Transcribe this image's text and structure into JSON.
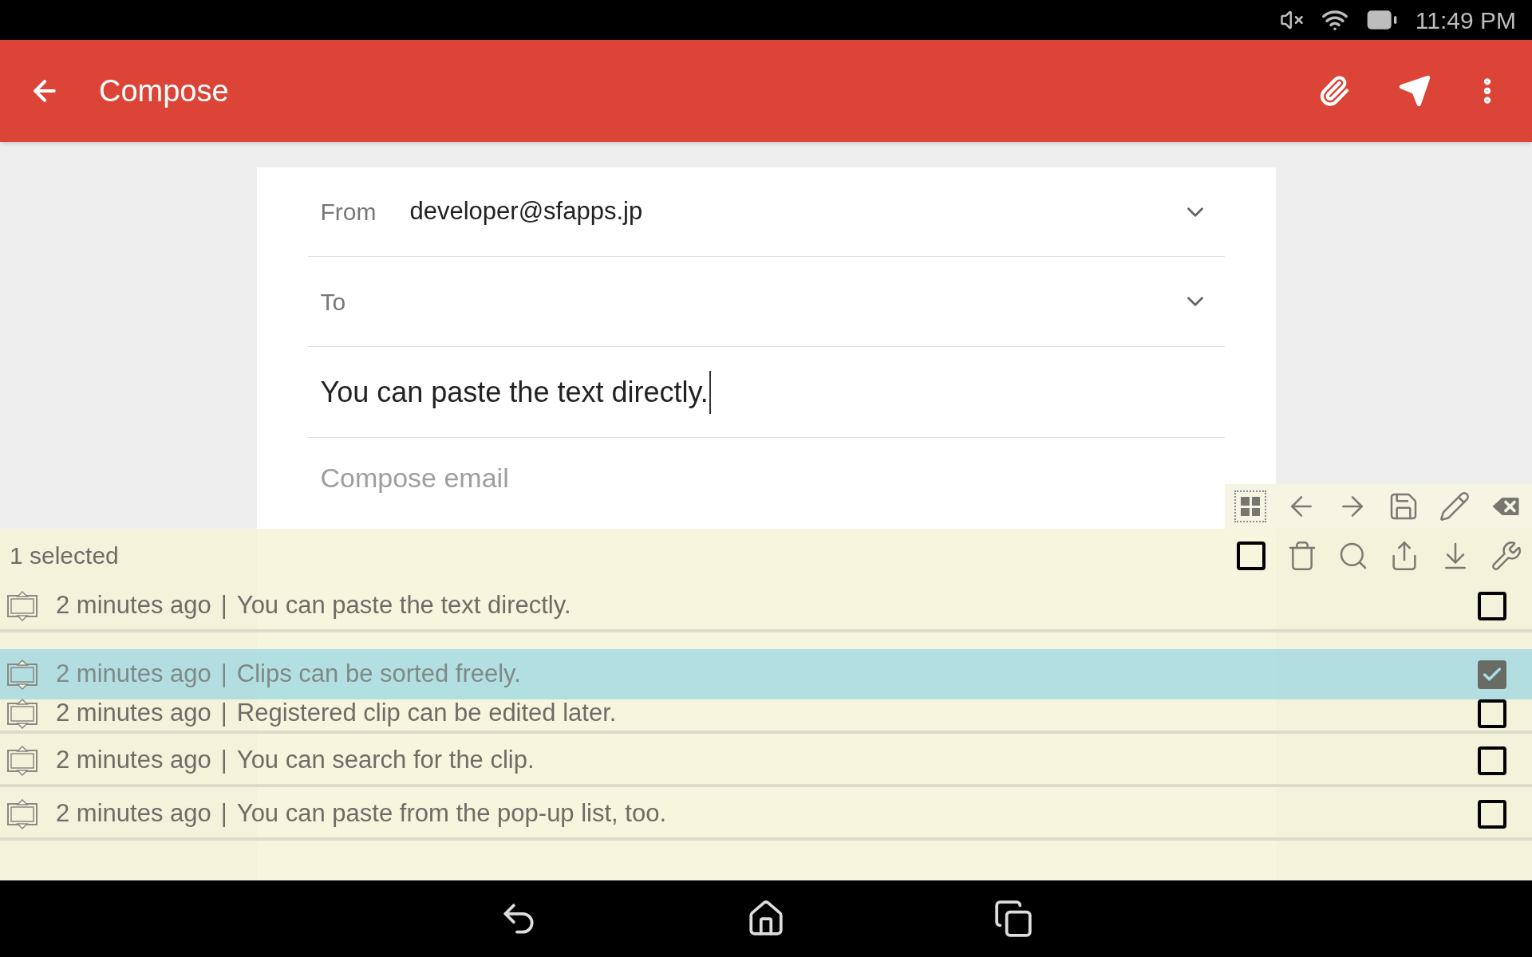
{
  "status_bar": {
    "time": "11:49 PM"
  },
  "app_bar": {
    "title": "Compose"
  },
  "form": {
    "from": {
      "label": "From",
      "value": "developer@sfapps.jp"
    },
    "to": {
      "label": "To"
    },
    "subject": {
      "value": "You can paste the text directly."
    },
    "body": {
      "placeholder": "Compose email"
    }
  },
  "clip_panel": {
    "status": "1 selected",
    "select_all": {
      "checked": false
    },
    "clips": [
      {
        "kind": "row",
        "time": "2 minutes ago",
        "separator": "|",
        "text": "You can paste the text directly.",
        "selected": false
      },
      {
        "kind": "dragged",
        "time": "2 minutes ago",
        "separator": "|",
        "text": "Clips can be sorted freely.",
        "selected": true
      },
      {
        "kind": "row",
        "time": "2 minutes ago",
        "separator": "|",
        "text": "Registered clip can be edited later.",
        "selected": false
      },
      {
        "kind": "row",
        "time": "2 minutes ago",
        "separator": "|",
        "text": "You can search for the clip.",
        "selected": false
      },
      {
        "kind": "row",
        "time": "2 minutes ago",
        "separator": "|",
        "text": "You can paste from the pop-up list, too.",
        "selected": false
      }
    ]
  }
}
